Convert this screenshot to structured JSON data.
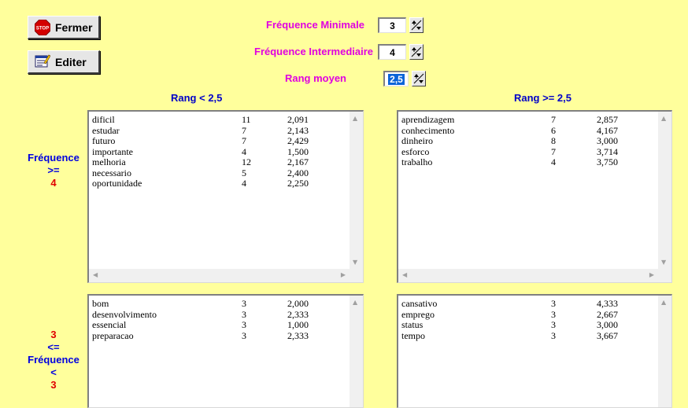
{
  "buttons": {
    "close_label": "Fermer",
    "edit_label": "Editer",
    "stop_icon_text": "STOP"
  },
  "params": {
    "min_freq_label": "Fréquence Minimale",
    "min_freq_value": "3",
    "inter_freq_label": "Fréquence Intermediaire",
    "inter_freq_value": "4",
    "rank_label": "Rang moyen",
    "rank_value": "2,5"
  },
  "columns": {
    "left_header": "Rang < 2,5",
    "right_header": "Rang >= 2,5"
  },
  "row_labels": {
    "top": [
      "Fréquence",
      ">=",
      "4"
    ],
    "bottom": [
      "3",
      "<=",
      "Fréquence",
      "<",
      "3"
    ]
  },
  "lists": {
    "top_left": [
      [
        "dificil",
        "11",
        "2,091"
      ],
      [
        "estudar",
        "7",
        "2,143"
      ],
      [
        "futuro",
        "7",
        "2,429"
      ],
      [
        "importante",
        "4",
        "1,500"
      ],
      [
        "melhoria",
        "12",
        "2,167"
      ],
      [
        "necessario",
        "5",
        "2,400"
      ],
      [
        "oportunidade",
        "4",
        "2,250"
      ]
    ],
    "top_right": [
      [
        "aprendizagem",
        "7",
        "2,857"
      ],
      [
        "conhecimento",
        "6",
        "4,167"
      ],
      [
        "dinheiro",
        "8",
        "3,000"
      ],
      [
        "esforco",
        "7",
        "3,714"
      ],
      [
        "trabalho",
        "4",
        "3,750"
      ]
    ],
    "bottom_left": [
      [
        "bom",
        "3",
        "2,000"
      ],
      [
        "desenvolvimento",
        "3",
        "2,333"
      ],
      [
        "essencial",
        "3",
        "1,000"
      ],
      [
        "preparacao",
        "3",
        "2,333"
      ]
    ],
    "bottom_right": [
      [
        "cansativo",
        "3",
        "4,333"
      ],
      [
        "emprego",
        "3",
        "2,667"
      ],
      [
        "status",
        "3",
        "3,000"
      ],
      [
        "tempo",
        "3",
        "3,667"
      ]
    ]
  },
  "colors": {
    "background": "#ffff9c",
    "param_label": "#e000e0",
    "column_header": "#0000c8",
    "row_label_blue": "#0000e0",
    "row_label_red": "#e00000"
  }
}
